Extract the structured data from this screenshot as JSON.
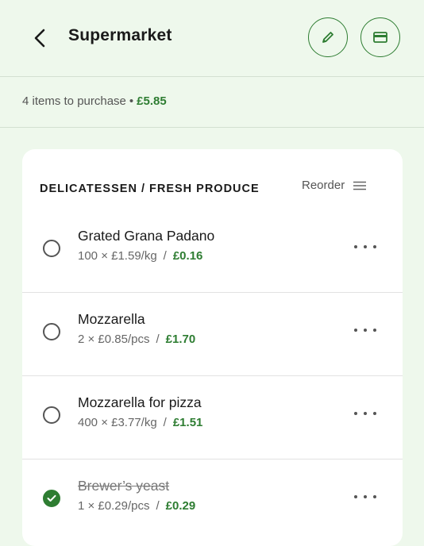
{
  "header": {
    "title": "Supermarket",
    "icons": {
      "back": "arrow-left-icon",
      "edit": "pencil-icon",
      "card": "credit-card-icon"
    }
  },
  "summary": {
    "count_text": "4 items to purchase",
    "separator": "•",
    "total": "£5.85"
  },
  "section": {
    "title": "DELICATESSEN / FRESH PRODUCE",
    "reorder_label": "Reorder"
  },
  "items": [
    {
      "name": "Grated Grana Padano",
      "qty_text": "100 × £1.59/kg",
      "price": "£0.16",
      "checked": false
    },
    {
      "name": "Mozzarella",
      "qty_text": "2 × £0.85/pcs",
      "price": "£1.70",
      "checked": false
    },
    {
      "name": "Mozzarella for pizza",
      "qty_text": "400 × £3.77/kg",
      "price": "£1.51",
      "checked": false
    },
    {
      "name": "Brewer’s yeast",
      "qty_text": "1 × £0.29/pcs",
      "price": "£0.29",
      "checked": true
    }
  ],
  "colors": {
    "accent": "#2e7d32",
    "background": "#eef8ec",
    "card": "#ffffff"
  }
}
